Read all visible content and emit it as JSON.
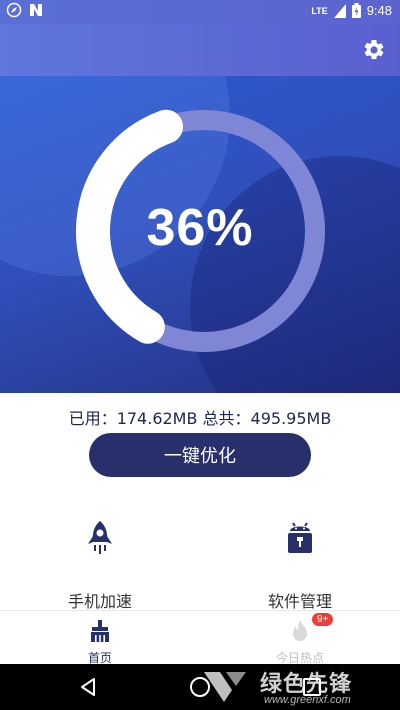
{
  "status_bar": {
    "network": "LTE",
    "time": "9:48"
  },
  "gauge": {
    "percent_text": "36%",
    "fraction": 0.36
  },
  "memory": {
    "text": "已用：174.62MB 总共：495.95MB"
  },
  "optimize_button": {
    "label": "一键优化"
  },
  "features": [
    {
      "label": "手机加速",
      "icon": "rocket-icon"
    },
    {
      "label": "软件管理",
      "icon": "android-package-icon"
    }
  ],
  "tabs": [
    {
      "label": "首页",
      "icon": "broom-icon",
      "active": true
    },
    {
      "label": "今日热点",
      "icon": "fire-icon",
      "badge": "9+"
    }
  ],
  "watermark": {
    "brand": "绿色先锋",
    "url": "www.greenxf.com"
  },
  "colors": {
    "accent": "#27306b",
    "hero_top": "#2d5ad0",
    "hero_bottom": "#24307f",
    "ring_track": "#7f86d6",
    "badge": "#e9403b"
  }
}
